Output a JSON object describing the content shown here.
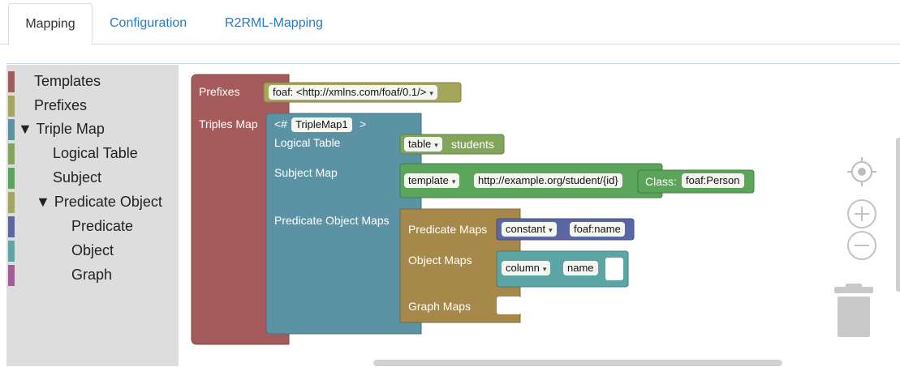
{
  "tabs": [
    {
      "label": "Mapping",
      "active": true
    },
    {
      "label": "Configuration",
      "active": false
    },
    {
      "label": "R2RML-Mapping",
      "active": false
    }
  ],
  "toolbox": {
    "items": [
      {
        "label": "Templates",
        "color": "#a55b5b"
      },
      {
        "label": "Prefixes",
        "color": "#a5a55b"
      },
      {
        "label": "▼ Triple Map",
        "color": "#5b93a5"
      },
      {
        "label": "Logical Table",
        "color": "#80a55b"
      },
      {
        "label": "Subject",
        "color": "#5ba55b"
      },
      {
        "label": "▼ Predicate Object",
        "color": "#a5a55b"
      },
      {
        "label": "Predicate",
        "color": "#5b67a5"
      },
      {
        "label": "Object",
        "color": "#5ba5a5"
      },
      {
        "label": "Graph",
        "color": "#a55b99"
      }
    ]
  },
  "blocks": {
    "prefixes_label": "Prefixes",
    "prefix_value": "foaf: <http://xmlns.com/foaf/0.1/>",
    "triples_map_label": "Triples Map",
    "triplemap_open": "<#",
    "triplemap_name": "TripleMap1",
    "triplemap_close": ">",
    "logical_table_label": "Logical Table",
    "table_dropdown": "table",
    "table_value": "students",
    "subject_map_label": "Subject Map",
    "template_dropdown": "template",
    "template_value": "http://example.org/student/{id}",
    "class_label": "Class:",
    "class_value": "foaf:Person",
    "pom_label": "Predicate Object Maps",
    "predicate_maps_label": "Predicate Maps",
    "constant_dropdown": "constant",
    "predicate_value": "foaf:name",
    "object_maps_label": "Object Maps",
    "column_dropdown": "column",
    "column_value": "name",
    "graph_maps_label": "Graph Maps"
  },
  "colors": {
    "templates_red": "#a55b5b",
    "prefix_olive": "#a5a55b",
    "triplemap_blue": "#5b93a5",
    "logical_green": "#80a55b",
    "subject_green": "#5ba55b",
    "pom_gold": "#a5884a",
    "predicate_blue": "#5b67a5",
    "object_teal": "#5ba5a5",
    "tab_link": "#2a7bc0"
  }
}
